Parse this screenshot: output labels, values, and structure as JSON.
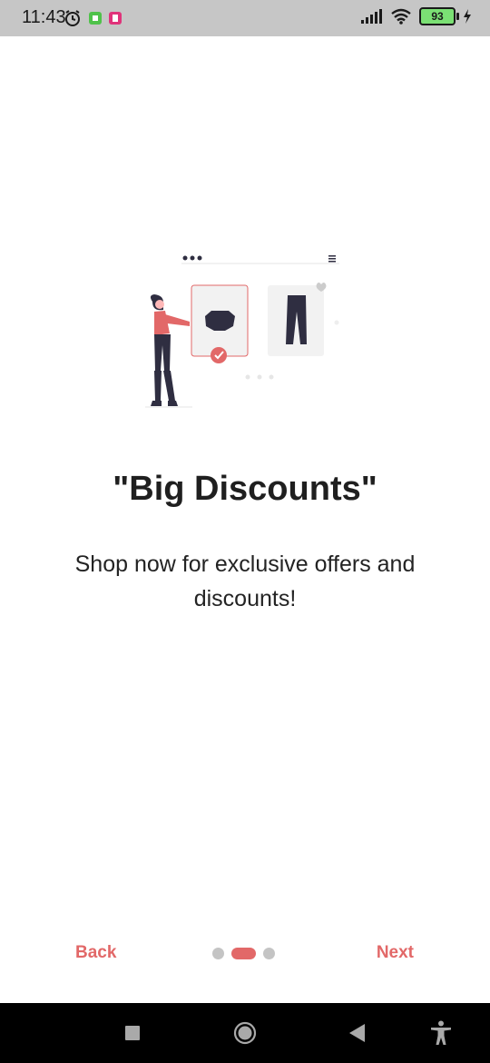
{
  "status_bar": {
    "time": "11:43",
    "battery": "93",
    "icons": [
      "alarm-icon",
      "app-notification-icon",
      "app-notification-icon",
      "signal-icon",
      "wifi-icon",
      "battery-icon",
      "charging-icon"
    ]
  },
  "onboarding": {
    "title": "\"Big Discounts\"",
    "subtitle": "Shop now for exclusive offers and discounts!",
    "illustration": "shopping-illustration"
  },
  "navigation": {
    "back_label": "Back",
    "next_label": "Next",
    "page_count": 3,
    "active_page": 2
  },
  "system_nav": {
    "buttons": [
      "recents-icon",
      "home-icon",
      "back-icon",
      "accessibility-icon"
    ]
  },
  "colors": {
    "accent": "#e26868",
    "status_bar_bg": "#c6c6c6",
    "dot_inactive": "#c4c4c4",
    "text": "#1f1f1f"
  }
}
